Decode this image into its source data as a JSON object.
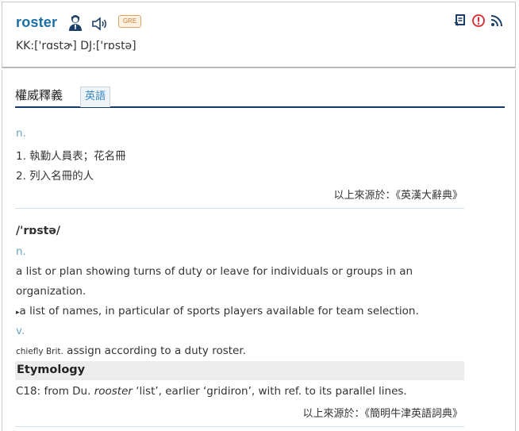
{
  "header": {
    "word": "roster",
    "badge": "GRE",
    "phonetic": "KK:['rɑstɚ] DJ:['rɒstə]",
    "icons": [
      "person-icon",
      "speaker-icon",
      "bookmark-icon",
      "report-icon",
      "rss-icon"
    ]
  },
  "tabs": {
    "main": "權威釋義",
    "english": "英語"
  },
  "section1": {
    "pos": "n.",
    "def1": "1. 執勤人員表；花名冊",
    "def2": "2. 列入名冊的人",
    "source": "以上來源於：《英漢大辭典》"
  },
  "section2": {
    "ipa": "/'rɒstə/",
    "pos_n": "n.",
    "def_n_line1": "a list or plan showing turns of duty or leave for individuals or groups in an",
    "def_n_line2": "organization.",
    "sub_marker": "▸",
    "sub_def": "a list of names, in particular of sports players available for team selection.",
    "pos_v": "v.",
    "v_label": "chiefly Brit.",
    "def_v": " assign according to a duty roster.",
    "etymology_heading": "Etymology",
    "ety_a": "C18: from Du. ",
    "ety_word": "rooster",
    "ety_b": " ‘list’, earlier ‘gridiron’, with ref. to its parallel lines.",
    "source": "以上來源於：《簡明牛津英語詞典》"
  },
  "colors": {
    "word": "#1a6fa3",
    "pos": "#6aa3c8",
    "tab_underline": "#123b6b",
    "badge_border": "#e0a46a"
  }
}
